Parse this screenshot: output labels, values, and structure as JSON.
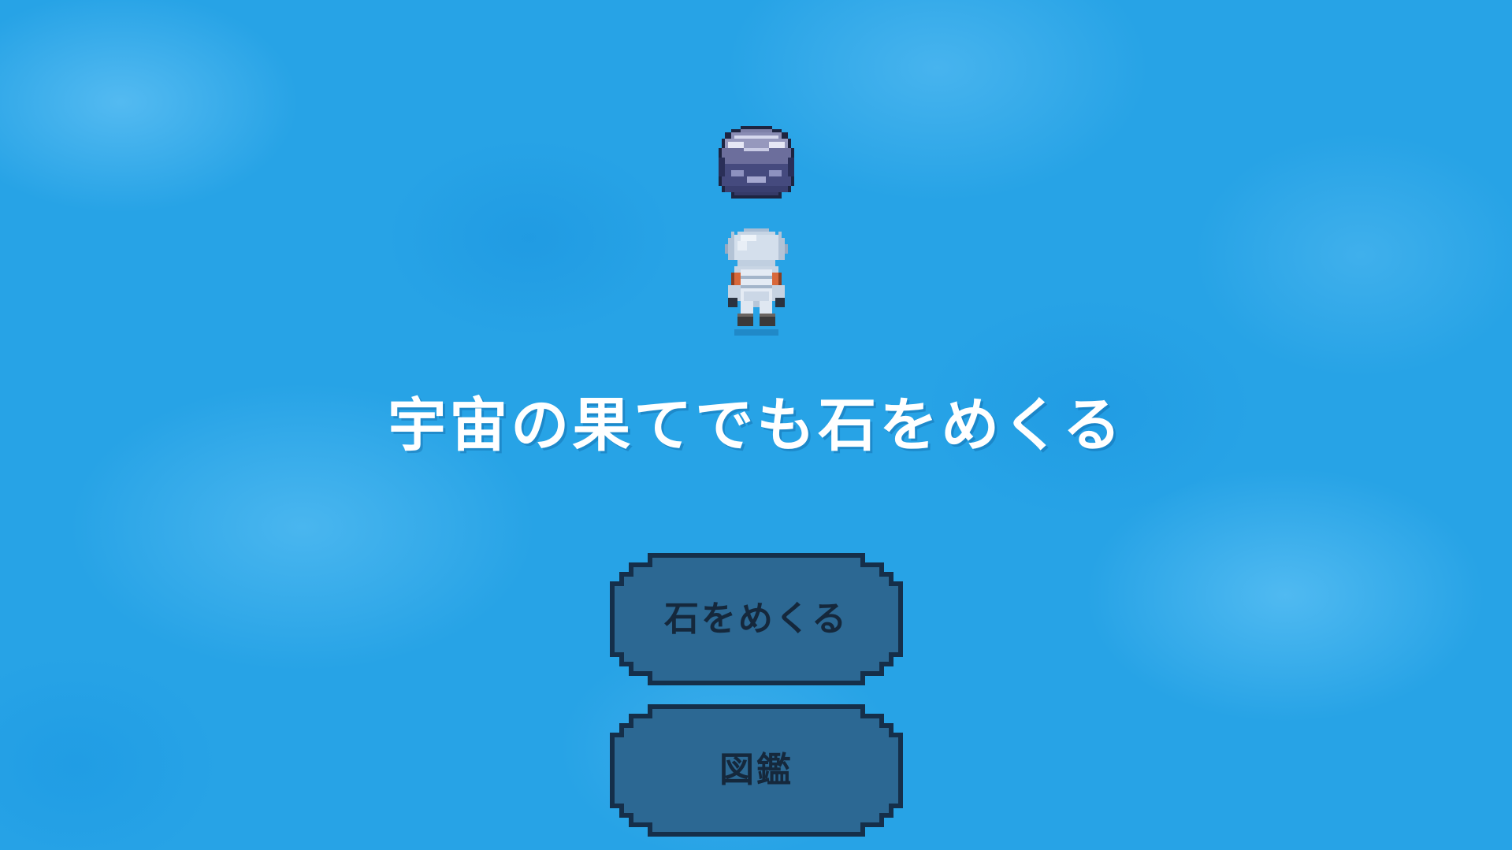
{
  "game": {
    "title": "宇宙の果てでも石をめくる",
    "menu": {
      "flip_button": "石をめくる",
      "encyclopedia_button": "図鑑"
    }
  },
  "icons": {
    "rock": "rock-sprite",
    "player": "astronaut-sprite"
  },
  "colors": {
    "sky": "#27a3e6",
    "button_fill": "#2c6893",
    "button_outline": "#152f4a",
    "button_text": "#15283c",
    "title_text": "#ffffff"
  }
}
